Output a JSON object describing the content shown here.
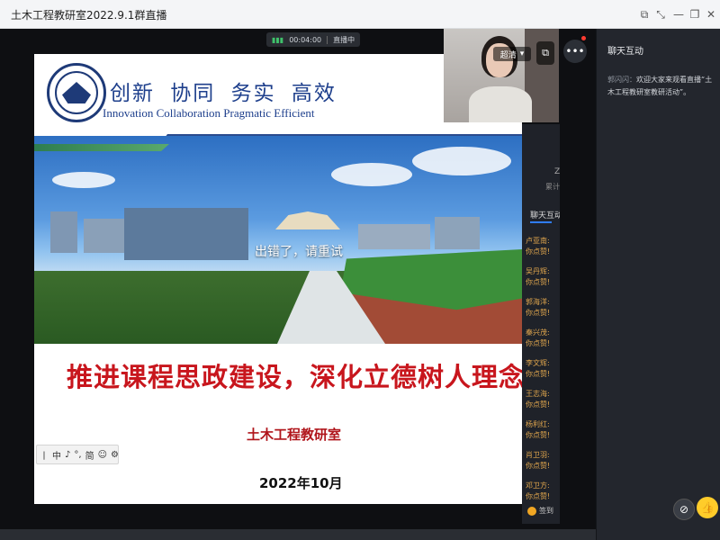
{
  "window": {
    "title": "土木工程教研室2022.9.1群直播",
    "controls": [
      "pin-icon",
      "expand-icon",
      "minimize-icon",
      "restore-icon",
      "close-icon"
    ]
  },
  "live": {
    "timer": "00:04:00",
    "status": "直播中"
  },
  "slide": {
    "motto_cn": "创新  协同  务实  高效",
    "motto_en": "Innovation Collaboration Pragmatic  Efficient",
    "overlay_error": "出错了，请重试",
    "main_title": "推进课程思政建设，深化立德树人理念",
    "organization": "土木工程教研室",
    "date": "2022年10月"
  },
  "ime_toolbar": {
    "items": [
      "丨",
      "中",
      "♪",
      "°,",
      "简",
      "☺",
      "⚙"
    ]
  },
  "camera": {
    "quality_label": "超清"
  },
  "inner_chat": {
    "header_initial": "Z",
    "header_sub": "累计观",
    "tab_label": "聊天互动",
    "messages": [
      {
        "name": "卢亚南:",
        "text": "你点赞!"
      },
      {
        "name": "吴丹辉:",
        "text": "你点赞!"
      },
      {
        "name": "郭海洋:",
        "text": "你点赞!"
      },
      {
        "name": "秦兴茂:",
        "text": "你点赞!"
      },
      {
        "name": "李文辉:",
        "text": "你点赞!"
      },
      {
        "name": "王志海:",
        "text": "你点赞!"
      },
      {
        "name": "杨利红:",
        "text": "你点赞!"
      },
      {
        "name": "肖卫羽:",
        "text": "你点赞!"
      },
      {
        "name": "邓卫方:",
        "text": "你点赞!"
      }
    ],
    "signin_label": "签到"
  },
  "sidebar": {
    "heading": "聊天互动",
    "message_author": "郭闪闪：",
    "message_text": "欢迎大家来观看直播“土木工程教研室教研活动”。"
  },
  "colors": {
    "title_red": "#c8161d",
    "brand_blue": "#1e3f8c",
    "like_yellow": "#ffcc2a",
    "chat_name": "#e0a64d"
  }
}
